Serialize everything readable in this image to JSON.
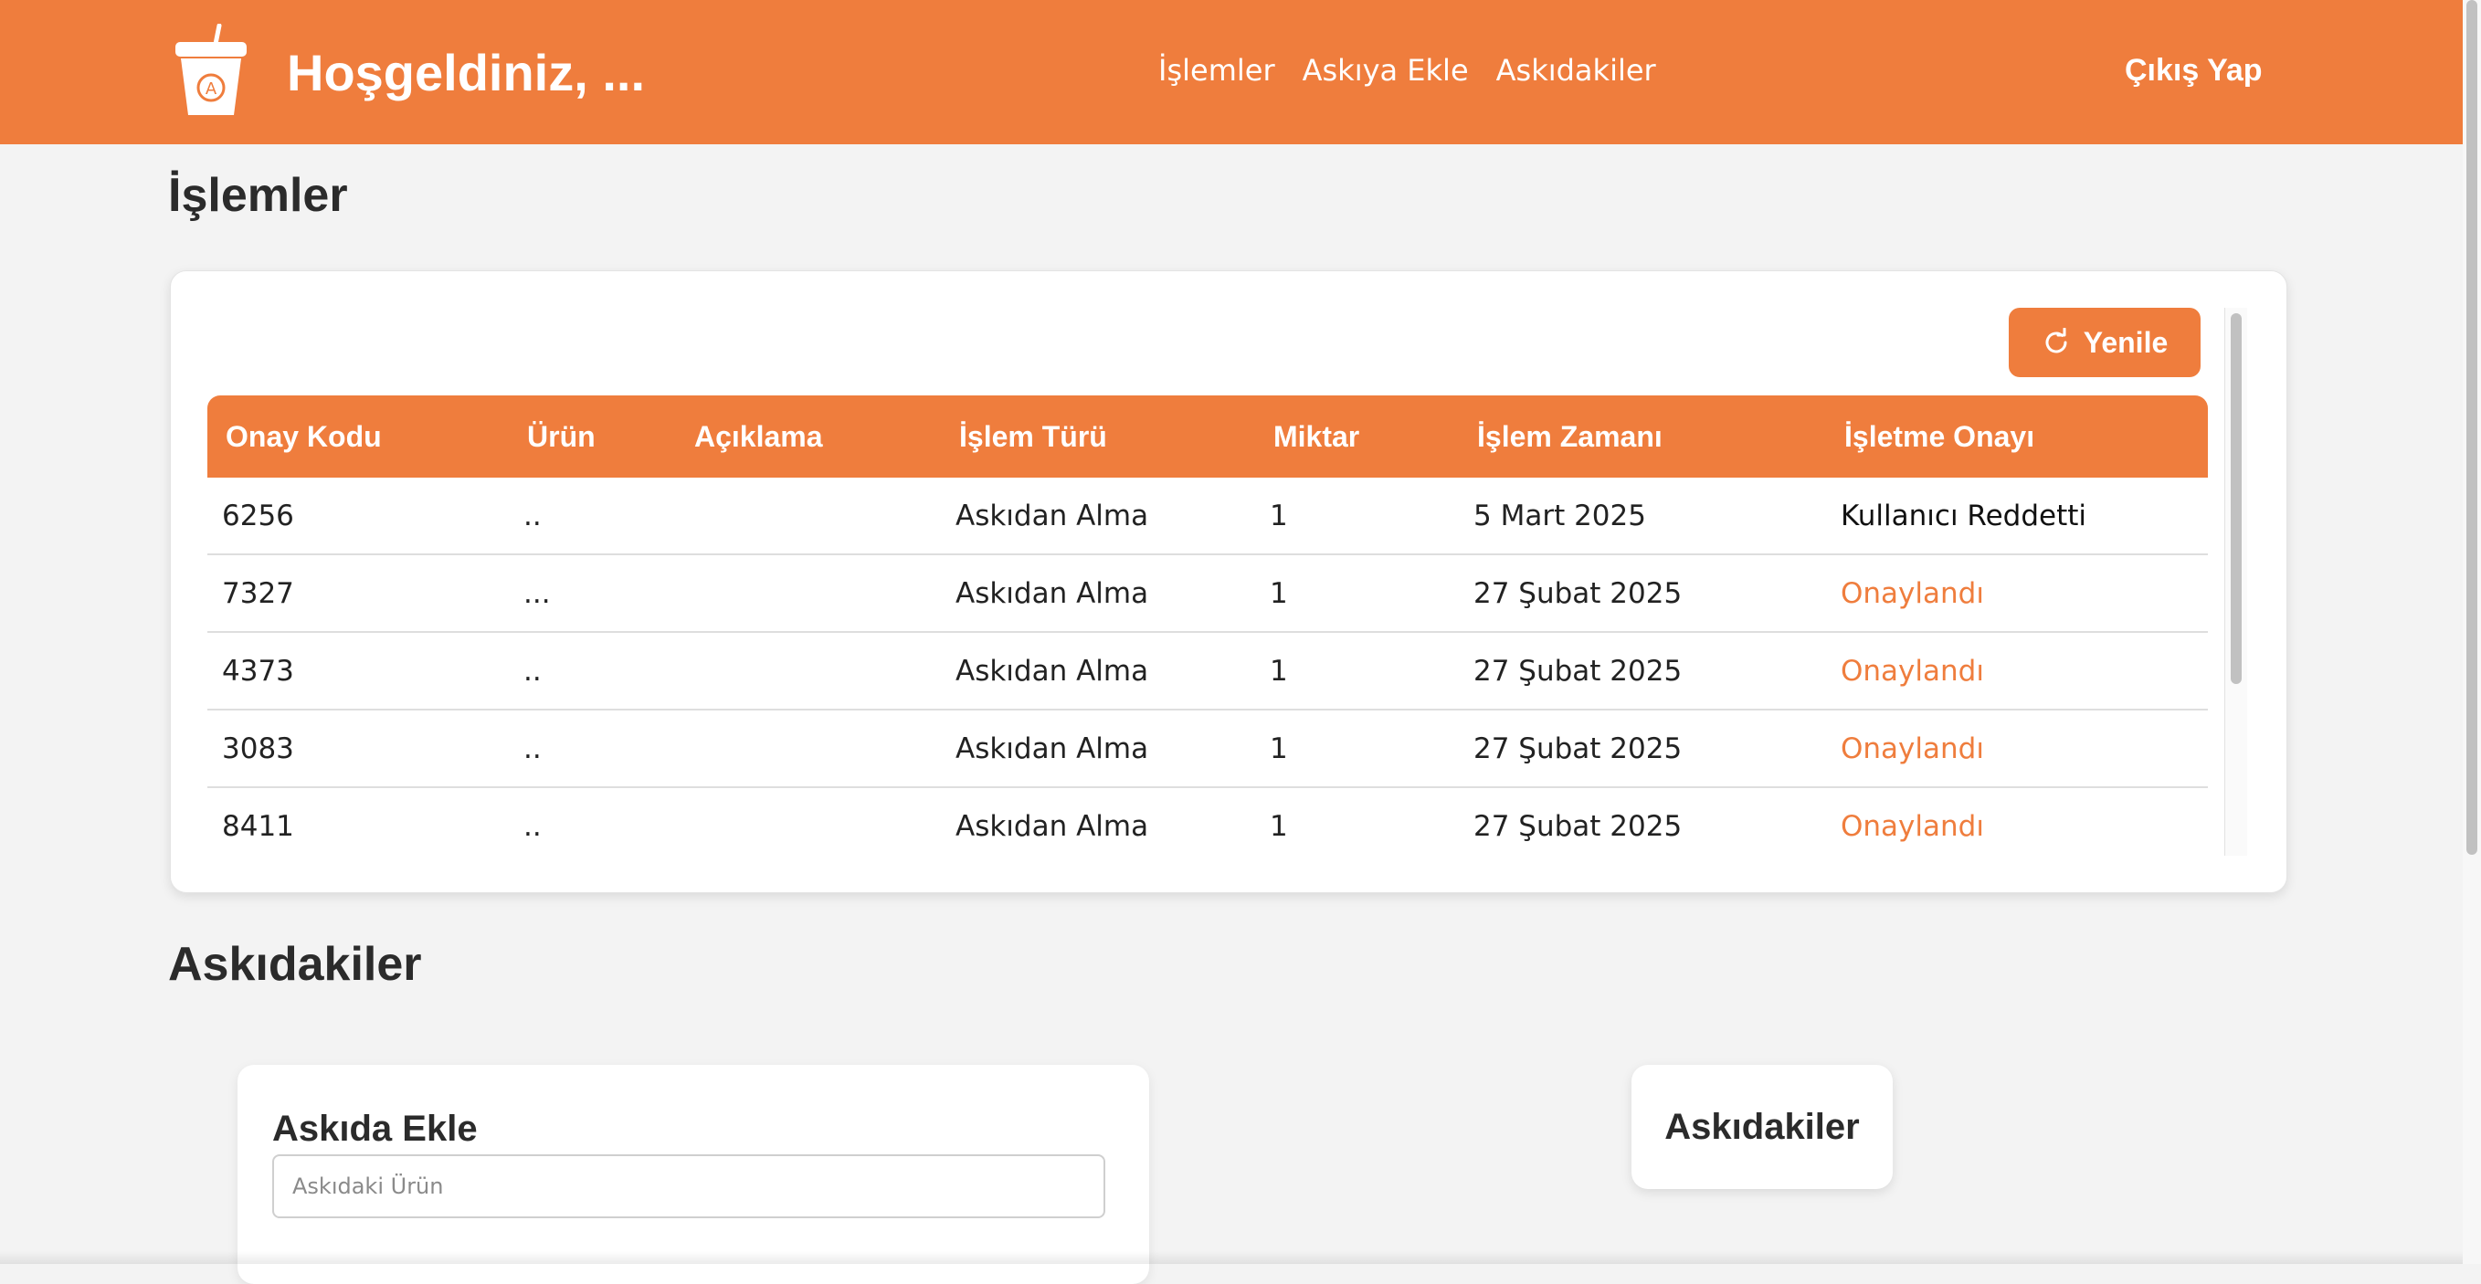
{
  "brand": {
    "logo_icon": "coffee-cup-icon",
    "accent_color": "#ef7d3d"
  },
  "header": {
    "welcome": "Hoşgeldiniz, ...",
    "nav": [
      "İşlemler",
      "Askıya Ekle",
      "Askıdakiler"
    ],
    "logout": "Çıkış Yap"
  },
  "transactions": {
    "title": "İşlemler",
    "refresh_label": "Yenile",
    "refresh_icon": "refresh-icon",
    "columns": [
      "Onay Kodu",
      "Ürün",
      "Açıklama",
      "İşlem Türü",
      "Miktar",
      "İşlem Zamanı",
      "İşletme Onayı"
    ],
    "rows": [
      [
        "6256",
        "..",
        "",
        "Askıdan Alma",
        "1",
        "5 Mart 2025",
        "Kullanıcı Reddetti"
      ],
      [
        "7327",
        "...",
        "",
        "Askıdan Alma",
        "1",
        "27 Şubat 2025",
        "Onaylandı"
      ],
      [
        "4373",
        "..",
        "",
        "Askıdan Alma",
        "1",
        "27 Şubat 2025",
        "Onaylandı"
      ],
      [
        "3083",
        "..",
        "",
        "Askıdan Alma",
        "1",
        "27 Şubat 2025",
        "Onaylandı"
      ],
      [
        "8411",
        "..",
        "",
        "Askıdan Alma",
        "1",
        "27 Şubat 2025",
        "Onaylandı"
      ]
    ]
  },
  "askidakiler": {
    "title": "Askıdakiler",
    "add_title": "Askıda Ekle",
    "add_placeholder": "Askıdaki Ürün",
    "list_title": "Askıdakiler"
  }
}
